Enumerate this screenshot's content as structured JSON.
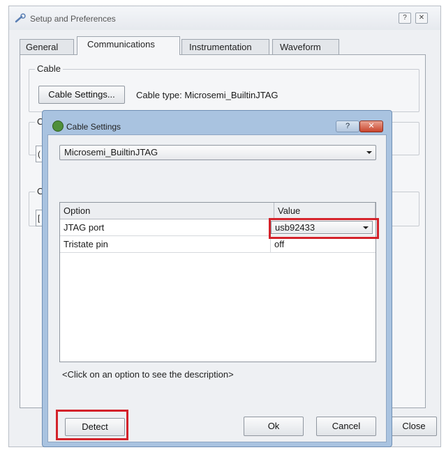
{
  "window": {
    "title": "Setup and Preferences",
    "help_btn": "?",
    "close_btn": "✕"
  },
  "tabs": [
    {
      "label": "General"
    },
    {
      "label": "Communications"
    },
    {
      "label": "Instrumentation"
    },
    {
      "label": "Waveform"
    }
  ],
  "cable_group": {
    "title": "Cable",
    "settings_button": "Cable Settings...",
    "cable_type_text": "Cable type: Microsemi_BuiltinJTAG"
  },
  "hidden_groups": [
    "C",
    "C"
  ],
  "hidden_fields": [
    "(",
    "["
  ],
  "outer_close_button": "Close",
  "dialog": {
    "title": "Cable Settings",
    "help_btn": "?",
    "close_btn": "✕",
    "cable_select": "Microsemi_BuiltinJTAG",
    "table": {
      "headers": [
        "Option",
        "Value"
      ],
      "rows": [
        {
          "option": "JTAG port",
          "value": "usb92433"
        },
        {
          "option": "Tristate pin",
          "value": "off"
        }
      ]
    },
    "hint": "<Click on an option to see the description>",
    "detect_button": "Detect",
    "ok_button": "Ok",
    "cancel_button": "Cancel"
  },
  "colors": {
    "highlight": "#d3222a",
    "dialog_frame": "#a9c3e0"
  }
}
